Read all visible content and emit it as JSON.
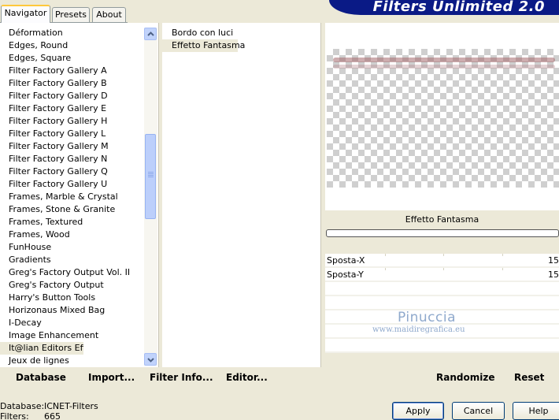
{
  "tabs": [
    "Navigator",
    "Presets",
    "About"
  ],
  "app_title": "Filters Unlimited 2.0",
  "categories": [
    "Déformation",
    "Edges, Round",
    "Edges, Square",
    "Filter Factory Gallery A",
    "Filter Factory Gallery B",
    "Filter Factory Gallery D",
    "Filter Factory Gallery E",
    "Filter Factory Gallery H",
    "Filter Factory Gallery L",
    "Filter Factory Gallery M",
    "Filter Factory Gallery N",
    "Filter Factory Gallery Q",
    "Filter Factory Gallery U",
    "Frames, Marble & Crystal",
    "Frames, Stone & Granite",
    "Frames, Textured",
    "Frames, Wood",
    "FunHouse",
    "Gradients",
    "Greg's Factory Output Vol. II",
    "Greg's Factory Output",
    "Harry's Button Tools",
    "Horizonaus Mixed Bag",
    "I-Decay",
    "Image Enhancement",
    "It@lian Editors Effect",
    "Jeux de lignes"
  ],
  "selected_category": "It@lian Editors Effect",
  "filters": [
    "Bordo con luci",
    "Effetto Fantasma"
  ],
  "selected_filter": "Effetto Fantasma",
  "current_filter_name": "Effetto Fantasma",
  "params": [
    {
      "label": "Sposta-X",
      "value": "15"
    },
    {
      "label": "Sposta-Y",
      "value": "15"
    }
  ],
  "watermark": {
    "name": "Pinuccia",
    "url": "www.maidiregrafica.eu"
  },
  "toolbar": {
    "database": "Database",
    "import": "Import...",
    "filter_info": "Filter Info...",
    "editor": "Editor...",
    "randomize": "Randomize",
    "reset": "Reset"
  },
  "status": {
    "database_label": "Database:",
    "database_value": "ICNET-Filters",
    "filters_label": "Filters:",
    "filters_value": "665"
  },
  "buttons": {
    "apply": "Apply",
    "cancel": "Cancel",
    "help": "Help"
  },
  "colors": {
    "banner": "#0a1a86",
    "selection": "#ece9d8",
    "window_bg": "#ece9d8"
  }
}
